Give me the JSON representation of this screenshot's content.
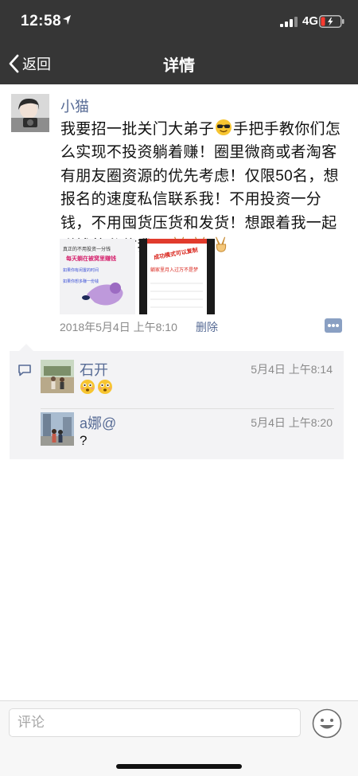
{
  "status_bar": {
    "time": "12:58",
    "network": "4G"
  },
  "nav": {
    "back_label": "返回",
    "title": "详情"
  },
  "post": {
    "author": "小猫",
    "text_before_emoji": "我要招一批关门大弟子",
    "text_after_emoji": "手把手教你们怎么实现不投资躺着赚！圈里微商或者淘客有朋友圈资源的优先考虑！仅限50名，想报名的速度私信联系我！不用投资一分钱，不用囤货压货和发货！想跟着我一起赚钱的私信我吧",
    "image1": {
      "line1": "真正的不用投资一分钱",
      "line2": "每天躺在被窝里赚钱",
      "line3": "如果你有闲置的时间",
      "line4": "如果你想多赚一份钱"
    },
    "image2": {
      "line1": "成功模式可以复制",
      "line2": "躺家里月入过万不是梦"
    },
    "timestamp": "2018年5月4日 上午8:10",
    "delete_label": "删除"
  },
  "comments": [
    {
      "author": "石开",
      "time": "5月4日 上午8:14",
      "text": ""
    },
    {
      "author": "a娜@",
      "time": "5月4日 上午8:20",
      "text": "?"
    }
  ],
  "input": {
    "placeholder": "评论"
  },
  "colors": {
    "header": "#363636",
    "link": "#576b95",
    "comment_bg": "#f3f3f5"
  }
}
